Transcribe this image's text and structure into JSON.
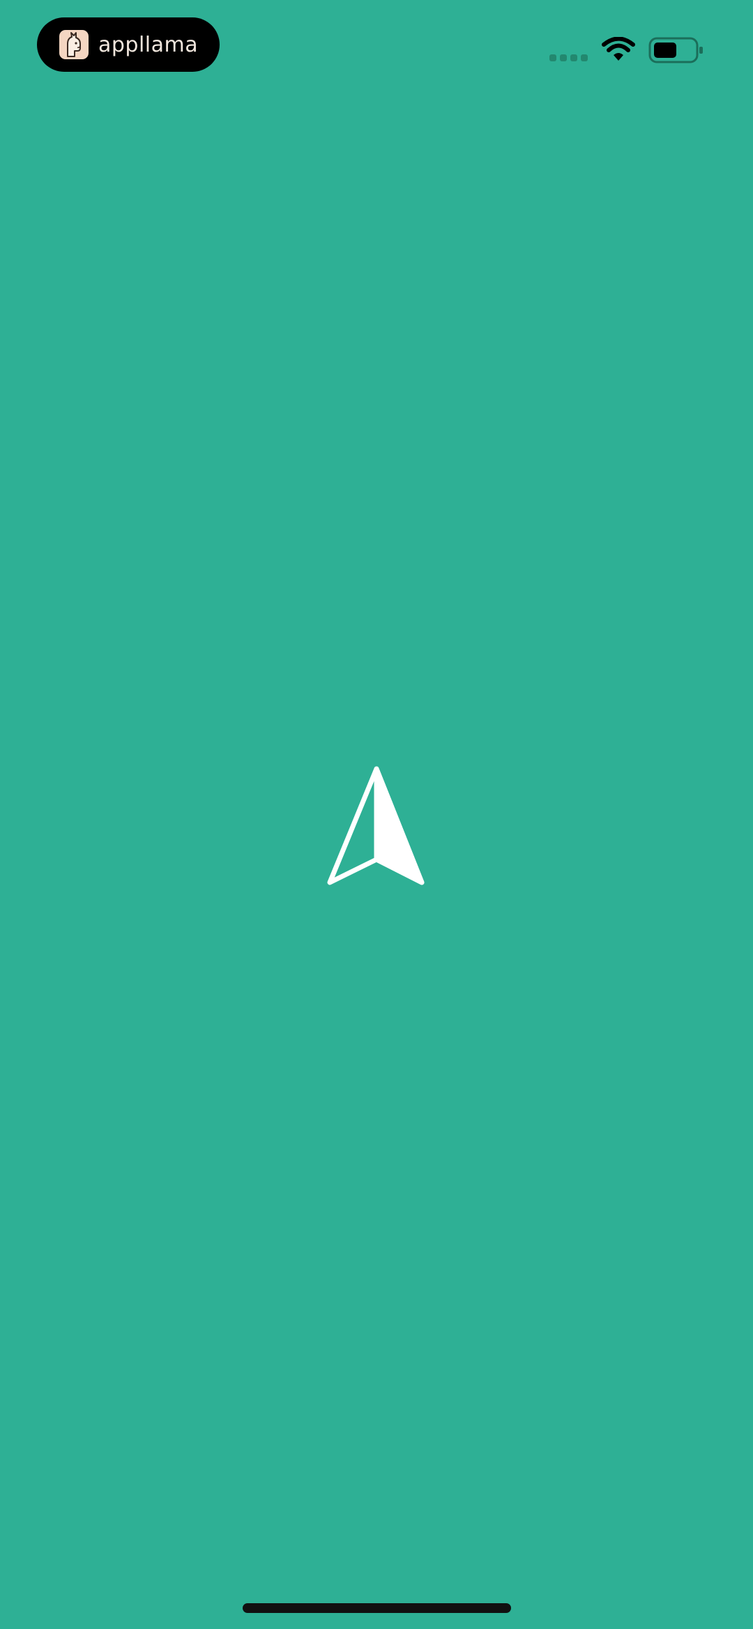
{
  "app": {
    "brand_name": "appllama",
    "brand_logo_icon": "llama-logo-icon",
    "background_color": "#2eb095"
  },
  "status_bar": {
    "signal_icon": "cellular-signal-icon",
    "wifi_icon": "wifi-icon",
    "battery_icon": "battery-icon"
  },
  "main": {
    "center_icon": "navigation-arrow-icon",
    "icon_color": "#ffffff"
  },
  "home_indicator_color": "#111111"
}
